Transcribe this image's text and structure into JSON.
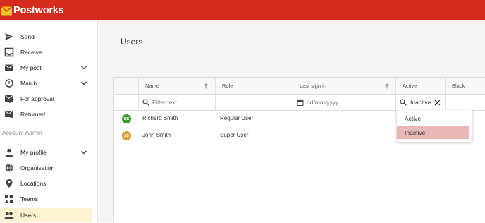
{
  "brand": {
    "name": "Postworks",
    "color": "#d52b1e"
  },
  "sidebar": {
    "items": [
      {
        "label": "Send",
        "icon": "send-icon"
      },
      {
        "label": "Receive",
        "icon": "inbox-icon"
      },
      {
        "label": "My post",
        "icon": "mail-icon",
        "expandable": true
      },
      {
        "label": "Match",
        "icon": "match-icon",
        "expandable": true
      },
      {
        "label": "For approval",
        "icon": "approval-icon"
      },
      {
        "label": "Returned",
        "icon": "returned-icon"
      }
    ],
    "section_label": "Account Admin",
    "admin_items": [
      {
        "label": "My profile",
        "icon": "person-icon",
        "expandable": true
      },
      {
        "label": "Organisation",
        "icon": "globe-icon"
      },
      {
        "label": "Locations",
        "icon": "location-pin-icon"
      },
      {
        "label": "Teams",
        "icon": "teams-icon"
      },
      {
        "label": "Users",
        "icon": "users-icon",
        "active": true
      }
    ]
  },
  "page": {
    "title": "Users"
  },
  "grid": {
    "columns": [
      "Name",
      "Role",
      "Last sign in",
      "Active",
      "Black"
    ],
    "filters": {
      "name_placeholder": "Filter text",
      "date_placeholder": "dd/mm/yyyy",
      "active_value": "Inactive"
    },
    "rows": [
      {
        "initials": "RS",
        "name": "Richard Smith",
        "role": "Regular User",
        "avatar_color": "#3a9a2f"
      },
      {
        "initials": "JS",
        "name": "John Smith",
        "role": "Super User",
        "avatar_color": "#d9a13a"
      }
    ]
  },
  "active_dropdown": {
    "options": [
      "Active",
      "Inactive"
    ],
    "selected": "Inactive"
  }
}
